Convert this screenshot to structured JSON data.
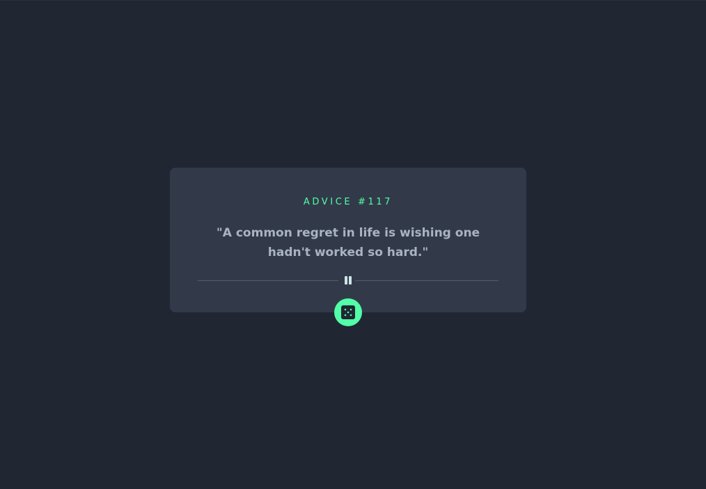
{
  "card": {
    "advice_id": "ADVICE #117",
    "quote": "\"A common regret in life is wishing one hadn't worked so hard.\""
  },
  "divider": {
    "icon": "pause-icon"
  },
  "dice_button": {
    "icon": "dice-icon"
  },
  "colors": {
    "background": "#202632",
    "card": "#323a49",
    "accent": "#52ffa8",
    "quote_text": "#a9b3c2",
    "divider": "#4f5d74"
  }
}
